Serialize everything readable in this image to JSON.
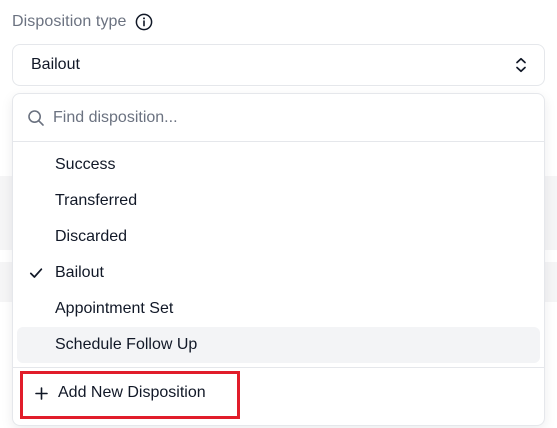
{
  "field": {
    "label": "Disposition type",
    "selected_value": "Bailout"
  },
  "dropdown": {
    "search_placeholder": "Find disposition...",
    "options": [
      {
        "label": "Success",
        "selected": false,
        "highlighted": false
      },
      {
        "label": "Transferred",
        "selected": false,
        "highlighted": false
      },
      {
        "label": "Discarded",
        "selected": false,
        "highlighted": false
      },
      {
        "label": "Bailout",
        "selected": true,
        "highlighted": false
      },
      {
        "label": "Appointment Set",
        "selected": false,
        "highlighted": false
      },
      {
        "label": "Schedule Follow Up",
        "selected": false,
        "highlighted": true
      }
    ],
    "add_label": "Add New Disposition"
  },
  "icons": {
    "info": "info-circle-icon",
    "chevron": "chevron-up-down-icon",
    "search": "search-icon",
    "check": "check-icon",
    "plus": "plus-icon"
  },
  "colors": {
    "highlight_outline": "#e11d2a",
    "label_muted": "#6b7280",
    "border": "#e5e7eb",
    "hover_bg": "#f3f4f6"
  }
}
